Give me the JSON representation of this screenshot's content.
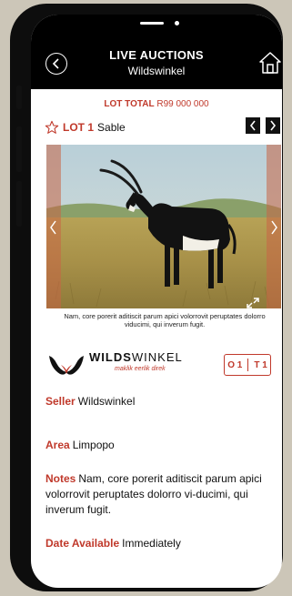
{
  "header": {
    "title": "LIVE AUCTIONS",
    "subtitle": "Wildswinkel"
  },
  "lot_total": {
    "label": "LOT TOTAL",
    "value": "R99 000 000"
  },
  "lot": {
    "number_label": "LOT 1",
    "name": "Sable"
  },
  "photo": {
    "caption": "Nam, core porerit aditiscit parum apici volorrovit peruptates dolorro viducimi, qui inverum fugit."
  },
  "brand": {
    "name_bold": "WILDS",
    "name_regular": "WINKEL",
    "tagline": "maklik eerlik direk"
  },
  "badge": {
    "left": "O 1",
    "right": "T 1"
  },
  "details": {
    "seller_label": "Seller",
    "seller_value": "Wildswinkel",
    "area_label": "Area",
    "area_value": "Limpopo",
    "notes_label": "Notes",
    "notes_value": "Nam, core porerit aditiscit parum apici volorrovit peruptates dolorro vi-ducimi, qui inverum fugit.",
    "date_label": "Date Available",
    "date_value": "Immediately"
  },
  "colors": {
    "accent": "#c0392b",
    "header_bg": "#000000",
    "device_bg": "#ccc6b8"
  }
}
